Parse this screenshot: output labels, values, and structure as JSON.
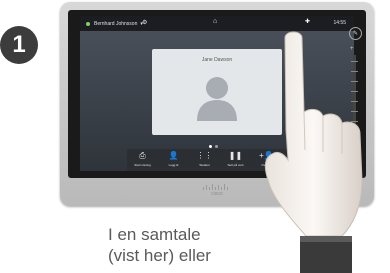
{
  "step": {
    "number": "1"
  },
  "call_screen": {
    "status_bar": {
      "user_name": "Bernhard Johnsson",
      "clock": "14:55"
    },
    "caller_name": "Jane Dawson",
    "toolbar": [
      {
        "label": "Start visning",
        "icon": "share-screen-icon"
      },
      {
        "label": "Legg til",
        "icon": "add-person-icon"
      },
      {
        "label": "Tastatur",
        "icon": "keypad-icon"
      },
      {
        "label": "Sett på vent",
        "icon": "pause-icon"
      },
      {
        "label": "Overfør",
        "icon": "transfer-icon"
      }
    ],
    "brand_logo": "cisco"
  },
  "caption": {
    "line1": "I en samtale",
    "line2": "(vist her) eller"
  }
}
